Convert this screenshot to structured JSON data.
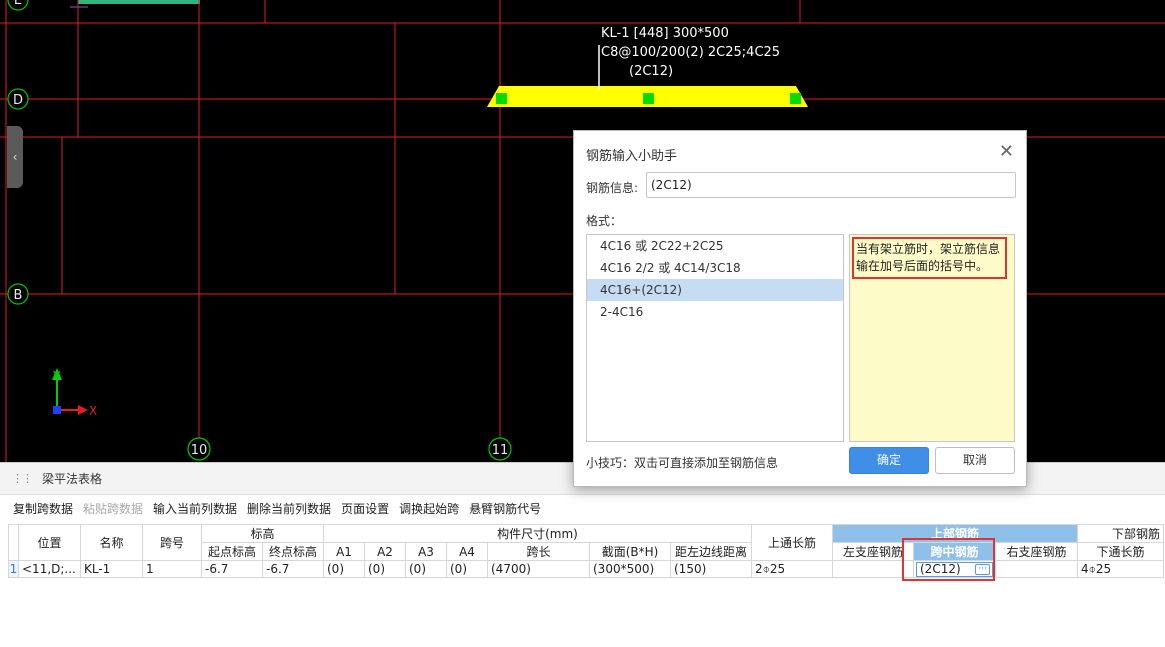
{
  "canvas": {
    "axis_labels": {
      "d": "D",
      "b": "B",
      "c10": "10",
      "c11": "11",
      "e": "E"
    },
    "beam_annotation": {
      "line1": "KL-1 [448] 300*500",
      "line2": "C8@100/200(2) 2C25;4C25",
      "line3": "(2C12)"
    },
    "ucs": {
      "y": "Y",
      "x": "X"
    },
    "colors": {
      "grid": "#e01e1e",
      "beam": "#ffff00",
      "grip": "#00dd00",
      "axis_circle": "#00c800"
    }
  },
  "panel": {
    "title": "梁平法表格",
    "toolbar": [
      {
        "label": "复制跨数据",
        "enabled": true
      },
      {
        "label": "粘贴跨数据",
        "enabled": false
      },
      {
        "label": "输入当前列数据",
        "enabled": true
      },
      {
        "label": "删除当前列数据",
        "enabled": true
      },
      {
        "label": "页面设置",
        "enabled": true
      },
      {
        "label": "调换起始跨",
        "enabled": true
      },
      {
        "label": "悬臂钢筋代号",
        "enabled": true
      }
    ],
    "table": {
      "headers": {
        "position": "位置",
        "name": "名称",
        "span": "跨号",
        "elev_group": "标高",
        "elev_start": "起点标高",
        "elev_end": "终点标高",
        "size_group": "构件尺寸(mm)",
        "a1": "A1",
        "a2": "A2",
        "a3": "A3",
        "a4": "A4",
        "span_len": "跨长",
        "section": "截面(B*H)",
        "offset": "距左边线距离",
        "top_through": "上通长筋",
        "top_group": "上部钢筋",
        "left_support": "左支座钢筋",
        "mid": "跨中钢筋",
        "right_support": "右支座钢筋",
        "bottom_group": "下部钢筋",
        "bottom_through": "下通长筋"
      },
      "row": {
        "row_no": "1",
        "position": "<11,D;...",
        "name": "KL-1",
        "span": "1",
        "elev_start": "-6.7",
        "elev_end": "-6.7",
        "a1": "(0)",
        "a2": "(0)",
        "a3": "(0)",
        "a4": "(0)",
        "span_len": "(4700)",
        "section": "(300*500)",
        "offset": "(150)",
        "top_through": "2⌽25",
        "left_support": "",
        "mid": "(2C12)",
        "right_support": "",
        "bottom_through": "4⌽25"
      }
    }
  },
  "dialog": {
    "title": "钢筋输入小助手",
    "info_label": "钢筋信息:",
    "info_value": "(2C12)",
    "format_label": "格式：",
    "formats": [
      "4C16 或 2C22+2C25",
      "4C16 2/2 或 4C14/3C18",
      "4C16+(2C12)",
      "2-4C16"
    ],
    "selected_index": 2,
    "hint": "当有架立筋时，架立筋信息输在加号后面的括号中。",
    "tip": "小技巧：双击可直接添加至钢筋信息",
    "ok_label": "确定",
    "cancel_label": "取消"
  }
}
